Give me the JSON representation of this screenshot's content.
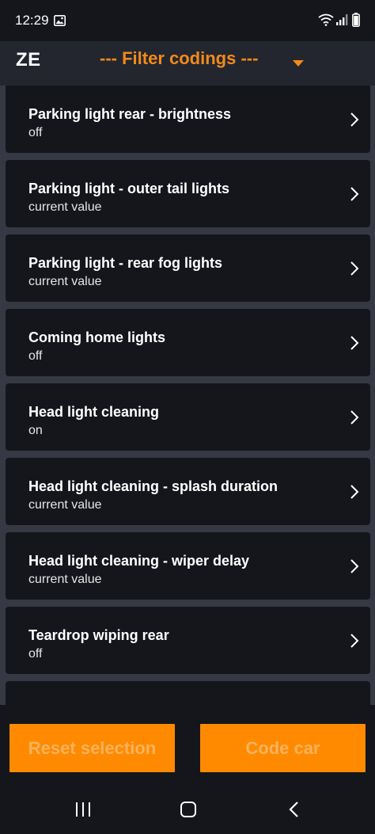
{
  "status_bar": {
    "time": "12:29"
  },
  "app_bar": {
    "title": "ZE",
    "filter_label": "--- Filter codings ---"
  },
  "codings": [
    {
      "title": "Parking light rear - brightness",
      "value": "off"
    },
    {
      "title": "Parking light - outer tail lights",
      "value": "current value"
    },
    {
      "title": "Parking light - rear fog lights",
      "value": "current value"
    },
    {
      "title": "Coming home lights",
      "value": "off"
    },
    {
      "title": "Head light cleaning",
      "value": "on"
    },
    {
      "title": "Head light cleaning - splash duration",
      "value": "current value"
    },
    {
      "title": "Head light cleaning - wiper delay",
      "value": "current value"
    },
    {
      "title": "Teardrop wiping rear",
      "value": "off"
    }
  ],
  "actions": {
    "reset_label": "Reset selection",
    "code_label": "Code car"
  },
  "colors": {
    "accent": "#f28a1c",
    "button": "#ff8a00",
    "card": "#14161c",
    "list_background": "#363943"
  },
  "icons": {
    "status": [
      "image-icon",
      "wifi-icon",
      "signal-icon",
      "battery-icon"
    ],
    "dropdown": "caret-down-icon",
    "row": "chevron-right-icon",
    "nav": [
      "recents-icon",
      "home-icon",
      "back-icon"
    ]
  }
}
